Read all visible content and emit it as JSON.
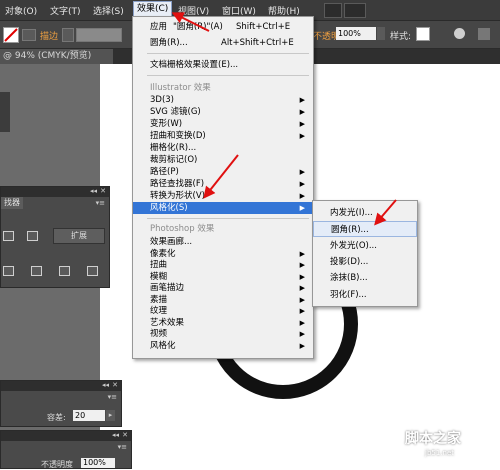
{
  "menubar": {
    "items": [
      "对象(O)",
      "文字(T)",
      "选择(S)",
      "效果(C)",
      "视图(V)",
      "窗口(W)",
      "帮助(H)"
    ]
  },
  "controlbar": {
    "stroke_label": "描边",
    "opacity_label": "不透明度",
    "opacity_value": "100%",
    "style_label": "样式:"
  },
  "doc_tab": "@ 94% (CMYK/预览)",
  "effect_menu": {
    "apply_label": "应用",
    "apply_sub": "\"圆角(R)\"(A)",
    "apply_shortcut": "Shift+Ctrl+E",
    "round_label": "圆角(R)...",
    "round_shortcut": "Alt+Shift+Ctrl+E",
    "doc_raster": "文档栅格效果设置(E)...",
    "illustrator_header": "Illustrator 效果",
    "illustrator_items": [
      "3D(3)",
      "SVG 滤镜(G)",
      "变形(W)",
      "扭曲和变换(D)",
      "栅格化(R)...",
      "裁剪标记(O)",
      "路径(P)",
      "路径查找器(F)",
      "转换为形状(V)",
      "风格化(S)"
    ],
    "photoshop_header": "Photoshop 效果",
    "photoshop_items": [
      "效果画廊...",
      "像素化",
      "扭曲",
      "模糊",
      "画笔描边",
      "素描",
      "纹理",
      "艺术效果",
      "视频",
      "风格化"
    ]
  },
  "stylize_submenu": {
    "items": [
      "内发光(I)...",
      "圆角(R)...",
      "外发光(O)...",
      "投影(D)...",
      "涂抹(B)...",
      "羽化(F)..."
    ],
    "highlighted_index": 1
  },
  "pathfinder_panel": {
    "tab": "找器",
    "expand_label": "扩展"
  },
  "bottom_panel": {
    "tolerance_label": "容差:",
    "tolerance_value": "20",
    "opacity_label": "不透明度",
    "opacity_value": "100%"
  },
  "watermark": {
    "site": "jb51.net",
    "name": "脚本之家"
  }
}
